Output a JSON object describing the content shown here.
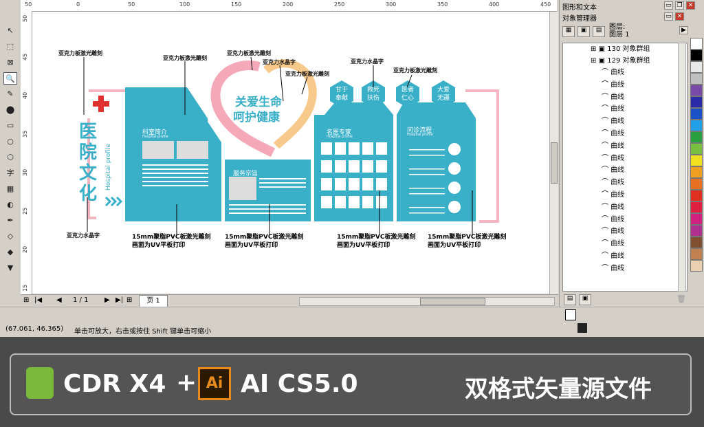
{
  "rulers": {
    "top": [
      "50",
      "0",
      "50",
      "100",
      "150",
      "200",
      "250",
      "300",
      "350",
      "400",
      "450",
      "500"
    ],
    "left": [
      "50",
      "45",
      "40",
      "35",
      "30",
      "25",
      "20",
      "15"
    ]
  },
  "toolbox": {
    "icons": [
      "pick-tool-icon",
      "shape-tool-icon",
      "crop-tool-icon",
      "zoom-tool-icon",
      "freehand-tool-icon",
      "smart-fill-icon",
      "rectangle-tool-icon",
      "ellipse-tool-icon",
      "polygon-tool-icon",
      "text-tool-icon",
      "table-tool-icon",
      "interactive-fill-icon",
      "eyedropper-icon",
      "outline-tool-icon",
      "fill-tool-icon",
      "interactive-fill-2-icon"
    ]
  },
  "docker": {
    "title_top": "图形和文本",
    "title": "对象管理器",
    "layer_info": [
      "图层:",
      "图层 1"
    ],
    "groups": [
      {
        "label": "130 对象群组"
      },
      {
        "label": "129 对象群组"
      }
    ],
    "curve_label": "曲线",
    "curve_count": 17
  },
  "palette": [
    "#ffffff",
    "#000000",
    "#e8e8e8",
    "#c0c0c0",
    "#7a4aa8",
    "#2a2aa8",
    "#1a50c8",
    "#20a0e8",
    "#2aa040",
    "#7ac040",
    "#f0e020",
    "#f0a020",
    "#e87020",
    "#e03020",
    "#e02040",
    "#d02080",
    "#b03090",
    "#805030",
    "#c08050",
    "#e8d0b0"
  ],
  "navigator": {
    "page_count": "1 / 1",
    "page_tab": "页 1"
  },
  "status": {
    "coords": "(67.061, 46.365)",
    "hint": "单击可放大，右击或按住 Shift 键单击可缩小"
  },
  "design": {
    "hospital_title": "医院文化",
    "hospital_sub": "Hospital profile",
    "heart_line1": "关爱生命",
    "heart_line2": "呵护健康",
    "hexes": [
      "甘于奉献",
      "救死扶伤",
      "医者仁心",
      "大爱无疆"
    ],
    "panel1_title": "科室简介",
    "panel1_sub": "Hospital profile",
    "panel2_title": "服务宗旨",
    "panel3_title": "名医专家",
    "panel3_sub": "Hospital profile",
    "panel4_title": "问诊流程",
    "panel4_sub": "Hospital profile",
    "labels": {
      "l1": "亚克力板激光雕刻",
      "l2": "亚克力板激光雕刻",
      "l3": "亚克力板激光雕刻",
      "l4": "亚克力水晶字",
      "l5": "亚克力板激光雕刻",
      "l6": "亚克力水晶字",
      "l7": "亚克力板激光雕刻",
      "l8": "亚克力水晶字"
    },
    "notes": {
      "n1a": "15mm聚脂PVC板激光雕刻",
      "n1b": "画面为UV平板打印",
      "n2a": "15mm聚脂PVC板激光雕刻",
      "n2b": "画面为UV平板打印",
      "n3a": "15mm聚脂PVC板激光雕刻",
      "n3b": "画面为UV平板打印",
      "n4a": "15mm聚脂PVC板激光雕刻",
      "n4b": "画面为UV平板打印"
    }
  },
  "banner": {
    "cdr": "CDR X4",
    "plus": "+",
    "ai_logo": "Ai",
    "ai": "AI CS5.0",
    "right": "双格式矢量源文件"
  }
}
